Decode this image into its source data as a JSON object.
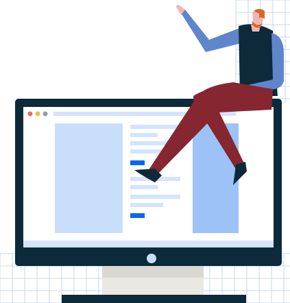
{
  "illustration": {
    "subject": "person-sitting-on-monitor",
    "icons": [
      "grid-background",
      "monitor-icon",
      "person-figure"
    ]
  },
  "browser": {
    "window_controls": [
      "close-dot",
      "minimize-dot",
      "maximize-dot"
    ]
  },
  "colors": {
    "monitor_frame": "#0C2A3A",
    "screen_bg": "#D3E4FD",
    "page_white": "#FFFFFF",
    "page_panel": "#C9DEFB",
    "text_line": "#D3E4FD",
    "accent_button": "#0A66F0",
    "side_panel": "#9CC2F8",
    "dot_red": "#E5705B",
    "dot_yellow": "#F0BC4A",
    "dot_grey": "#8CA0A5",
    "stand": "#DAD8D2",
    "base": "#EAE8E2",
    "base_bar": "#0C2A3A",
    "power_button": "#C9DEFB",
    "grid_line": "#C9D6EE",
    "sleeve": "#5F86CB",
    "vest": "#0C2A3A",
    "pants": "#852631",
    "skin": "#F3B4B4",
    "hair": "#D26B2B",
    "shoe": "#0C2A3A"
  }
}
